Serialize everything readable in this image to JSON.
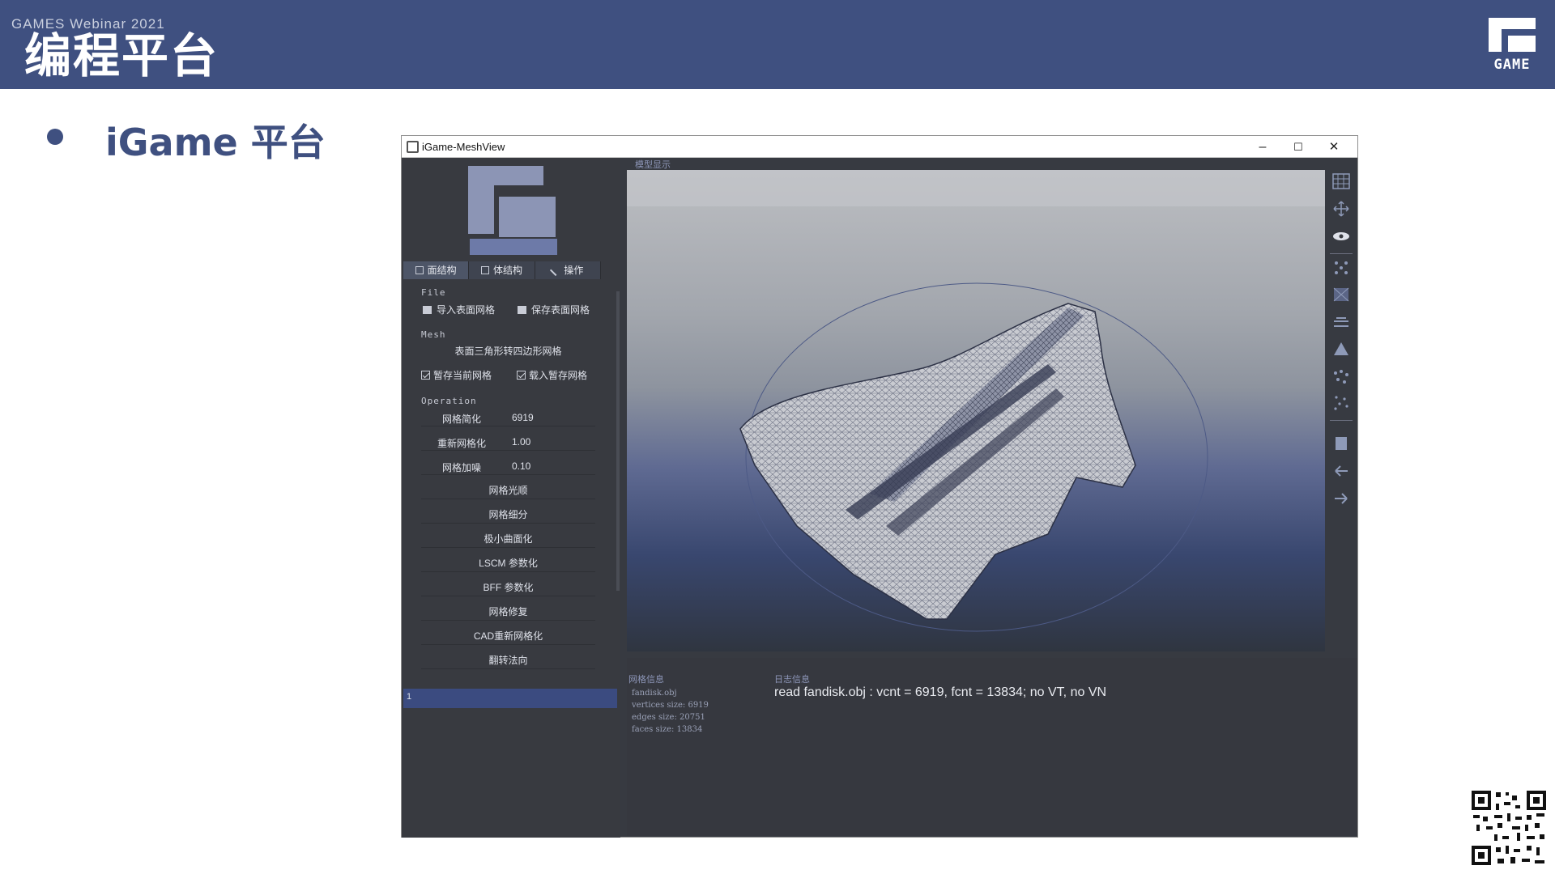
{
  "slide": {
    "banner_sub": "GAMES Webinar 2021",
    "title": "编程平台",
    "brand_label": "GAME",
    "bullet_text": "iGame 平台"
  },
  "window": {
    "title": "iGame-MeshView",
    "minimize": "–",
    "maximize": "☐",
    "close": "✕"
  },
  "sidebar": {
    "logo_label": "GAME",
    "tabs": [
      {
        "label": "面结构"
      },
      {
        "label": "体结构"
      },
      {
        "label": "操作"
      }
    ],
    "file_section": "File",
    "import_btn": "导入表面网格",
    "save_btn": "保存表面网格",
    "mesh_section": "Mesh",
    "tri_to_quad": "表面三角形转四边形网格",
    "temp_save": "暂存当前网格",
    "load_temp": "载入暂存网格",
    "operation_section": "Operation",
    "params": [
      {
        "label": "网格简化",
        "value": "6919"
      },
      {
        "label": "重新网格化",
        "value": "1.00"
      },
      {
        "label": "网格加噪",
        "value": "0.10"
      }
    ],
    "actions": [
      "网格光顺",
      "网格细分",
      "极小曲面化",
      "LSCM 参数化",
      "BFF 参数化",
      "网格修复",
      "CAD重新网格化",
      "翻转法向"
    ],
    "console_value": "1"
  },
  "viewport": {
    "label": "模型显示"
  },
  "bottom": {
    "mesh_info_title": "网格信息",
    "log_title": "日志信息",
    "mesh_file": "fandisk.obj",
    "vertices": "vertices size: 6919",
    "edges": "edges size: 20751",
    "faces": "faces size: 13834",
    "log_line": "read fandisk.obj : vcnt = 6919, fcnt = 13834; no VT, no VN"
  },
  "toolbar_icons": [
    "grid-icon",
    "move-icon",
    "eye-icon",
    "vertices-icon",
    "wireframe-icon",
    "flat-icon",
    "cone-icon",
    "points-icon",
    "scatter-icon",
    "stop-icon",
    "undo-icon",
    "redo-icon"
  ],
  "colors": {
    "banner": "#3f5080",
    "accent": "#3f5080",
    "panel": "#383a40",
    "console": "#3b4b80"
  }
}
